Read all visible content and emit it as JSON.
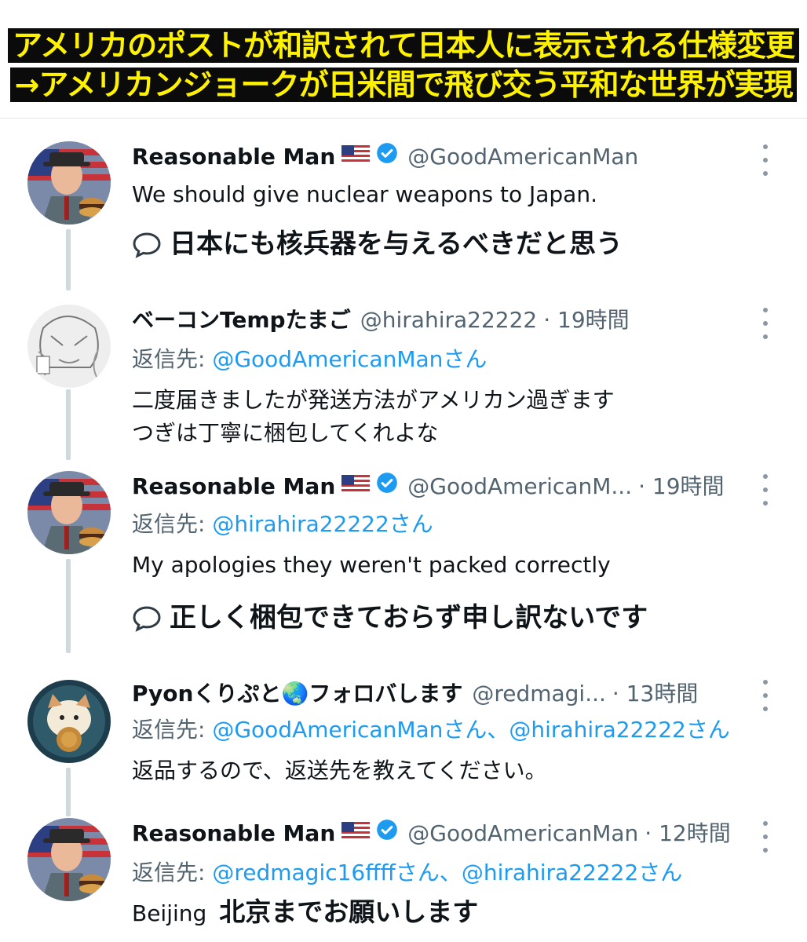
{
  "banner": {
    "line1": "アメリカのポストが和訳されて日本人に表示される仕様変更",
    "line2": "→アメリカンジョークが日米間で飛び交う平和な世界が実現"
  },
  "tweets": [
    {
      "name": "Reasonable Man",
      "handle": "@GoodAmericanMan",
      "time": "",
      "text": "We should give nuclear weapons to Japan.",
      "translation": "日本にも核兵器を与えるべきだと思う"
    },
    {
      "name": "ベーコンTempたまご",
      "handle": "@hirahira22222",
      "time": "· 19時間",
      "reply_label": "返信先:",
      "reply_to": "@GoodAmericanManさん",
      "text_line1": "二度届きましたが発送方法がアメリカン過ぎます",
      "text_line2": "つぎは丁寧に梱包してくれよな"
    },
    {
      "name": "Reasonable Man",
      "handle": "@GoodAmericanM...",
      "time": "· 19時間",
      "reply_label": "返信先:",
      "reply_to": "@hirahira22222さん",
      "text": "My apologies they weren't packed correctly",
      "translation": "正しく梱包できておらず申し訳ないです"
    },
    {
      "name": "Pyonくりぷと🌏フォロバします",
      "handle": "@redmagi...",
      "time": "· 13時間",
      "reply_label": "返信先:",
      "reply_to": "@GoodAmericanManさん、@hirahira22222さん",
      "text": "返品するので、返送先を教えてください。"
    },
    {
      "name": "Reasonable Man",
      "handle": "@GoodAmericanMan",
      "time": "· 12時間",
      "reply_label": "返信先:",
      "reply_to": "@redmagic16ffffさん、@hirahira22222さん",
      "text": "Beijing",
      "translation": "北京までお願いします"
    }
  ],
  "colors": {
    "banner_bg": "#0b0b0b",
    "banner_text": "#fff200",
    "link": "#1d9bf0",
    "muted": "#536471",
    "verified": "#1d9bf0"
  },
  "icons": [
    "us-flag-icon",
    "verified-badge-icon",
    "more-icon",
    "translation-bubble-icon"
  ]
}
